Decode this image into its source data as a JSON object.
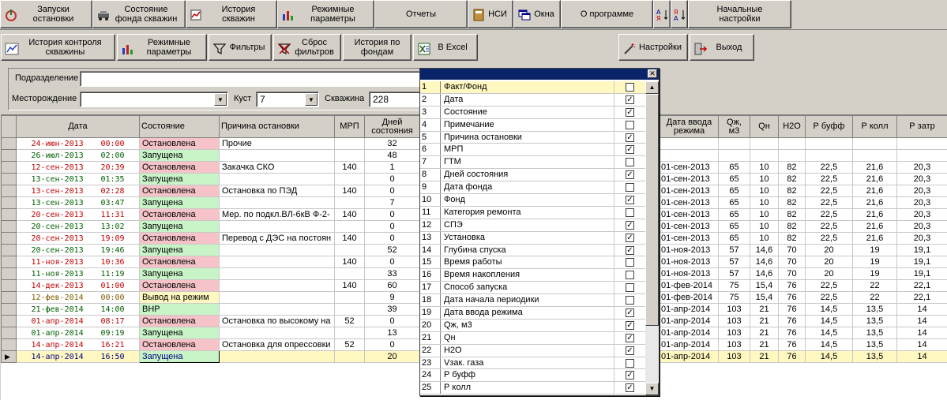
{
  "toolbar1": [
    {
      "label": "Запуски\nостановки",
      "icon": "power-icon"
    },
    {
      "label": "Состояние\nфонда скважин",
      "icon": "car-icon"
    },
    {
      "label": "История\nскважин",
      "icon": "history-icon"
    },
    {
      "label": "Режимные\nпараметры",
      "icon": "bar-chart-icon"
    },
    {
      "label": "Отчеты",
      "icon": ""
    },
    {
      "label": "НСИ",
      "icon": "book-icon"
    },
    {
      "label": "Окна",
      "icon": "windows-icon"
    },
    {
      "label": "О программе",
      "icon": ""
    },
    {
      "label": "",
      "icon": "sort-az-icon"
    },
    {
      "label": "",
      "icon": "sort-za-icon"
    },
    {
      "label": "Начальные\nнастройки",
      "icon": ""
    }
  ],
  "toolbar2": [
    {
      "label": "История контроля\nскважины",
      "icon": "chart-line-icon"
    },
    {
      "label": "Режимные\nпараметры",
      "icon": "bar-chart-icon"
    },
    {
      "label": "Фильтры",
      "icon": "filter-icon"
    },
    {
      "label": "Сброс\nфильтров",
      "icon": "filter-reset-icon"
    },
    {
      "label": "История по\nфондам",
      "icon": ""
    },
    {
      "label": "В Excel",
      "icon": "excel-icon"
    },
    {
      "label": "Настройки",
      "icon": "settings-wand-icon"
    },
    {
      "label": "Выход",
      "icon": "exit-icon"
    }
  ],
  "filter": {
    "division_label": "Подразделение",
    "division_value": "",
    "field_label": "Месторождение",
    "field_value": "",
    "pad_label": "Куст",
    "pad_value": "7",
    "well_label": "Скважина",
    "well_value": "228"
  },
  "grid": {
    "left_headers": [
      "Дата",
      "Состояние",
      "Причина остановки",
      "МРП",
      "Дней\nсостояния"
    ],
    "right_headers": [
      "Дата ввода\nрежима",
      "Qж,\nм3",
      "Qн",
      "H2O",
      "Р буфф",
      "Р колл",
      "Р затр"
    ],
    "rows": [
      {
        "date": "24-июн-2013",
        "time": "00:00",
        "state": "Остановлена",
        "reason": "Прочие",
        "mrp": "",
        "days": "32",
        "cls": "red",
        "rd": "",
        "qj": "",
        "qn": "",
        "h2o": "",
        "pb": "",
        "pk": "",
        "pz": ""
      },
      {
        "date": "26-июл-2013",
        "time": "02:00",
        "state": "Запущена",
        "reason": "",
        "mrp": "",
        "days": "48",
        "cls": "green",
        "rd": "",
        "qj": "",
        "qn": "",
        "h2o": "",
        "pb": "",
        "pk": "",
        "pz": ""
      },
      {
        "date": "12-сен-2013",
        "time": "20:39",
        "state": "Остановлена",
        "reason": "Закачка СКО",
        "mrp": "140",
        "days": "1",
        "cls": "red",
        "rd": "01-сен-2013",
        "qj": "65",
        "qn": "10",
        "h2o": "82",
        "pb": "22,5",
        "pk": "21,6",
        "pz": "20,3"
      },
      {
        "date": "13-сен-2013",
        "time": "01:35",
        "state": "Запущена",
        "reason": "",
        "mrp": "",
        "days": "0",
        "cls": "green",
        "rd": "01-сен-2013",
        "qj": "65",
        "qn": "10",
        "h2o": "82",
        "pb": "22,5",
        "pk": "21,6",
        "pz": "20,3"
      },
      {
        "date": "13-сен-2013",
        "time": "02:28",
        "state": "Остановлена",
        "reason": "Остановка по ПЭД",
        "mrp": "140",
        "days": "0",
        "cls": "red",
        "rd": "01-сен-2013",
        "qj": "65",
        "qn": "10",
        "h2o": "82",
        "pb": "22,5",
        "pk": "21,6",
        "pz": "20,3"
      },
      {
        "date": "13-сен-2013",
        "time": "03:47",
        "state": "Запущена",
        "reason": "",
        "mrp": "",
        "days": "7",
        "cls": "green",
        "rd": "01-сен-2013",
        "qj": "65",
        "qn": "10",
        "h2o": "82",
        "pb": "22,5",
        "pk": "21,6",
        "pz": "20,3"
      },
      {
        "date": "20-сен-2013",
        "time": "11:31",
        "state": "Остановлена",
        "reason": "Мер. по подкл.ВЛ-6кВ Ф-2-",
        "mrp": "140",
        "days": "0",
        "cls": "red",
        "rd": "01-сен-2013",
        "qj": "65",
        "qn": "10",
        "h2o": "82",
        "pb": "22,5",
        "pk": "21,6",
        "pz": "20,3"
      },
      {
        "date": "20-сен-2013",
        "time": "13:02",
        "state": "Запущена",
        "reason": "",
        "mrp": "",
        "days": "0",
        "cls": "green",
        "rd": "01-сен-2013",
        "qj": "65",
        "qn": "10",
        "h2o": "82",
        "pb": "22,5",
        "pk": "21,6",
        "pz": "20,3"
      },
      {
        "date": "20-сен-2013",
        "time": "19:09",
        "state": "Остановлена",
        "reason": "Перевод с ДЭС на постоян",
        "mrp": "140",
        "days": "0",
        "cls": "red",
        "rd": "01-сен-2013",
        "qj": "65",
        "qn": "10",
        "h2o": "82",
        "pb": "22,5",
        "pk": "21,6",
        "pz": "20,3"
      },
      {
        "date": "20-сен-2013",
        "time": "19:46",
        "state": "Запущена",
        "reason": "",
        "mrp": "",
        "days": "52",
        "cls": "green",
        "rd": "01-ноя-2013",
        "qj": "57",
        "qn": "14,6",
        "h2o": "70",
        "pb": "20",
        "pk": "19",
        "pz": "19,1"
      },
      {
        "date": "11-ноя-2013",
        "time": "10:36",
        "state": "Остановлена",
        "reason": "",
        "mrp": "140",
        "days": "0",
        "cls": "red",
        "rd": "01-ноя-2013",
        "qj": "57",
        "qn": "14,6",
        "h2o": "70",
        "pb": "20",
        "pk": "19",
        "pz": "19,1"
      },
      {
        "date": "11-ноя-2013",
        "time": "11:19",
        "state": "Запущена",
        "reason": "",
        "mrp": "",
        "days": "33",
        "cls": "green",
        "rd": "01-ноя-2013",
        "qj": "57",
        "qn": "14,6",
        "h2o": "70",
        "pb": "20",
        "pk": "19",
        "pz": "19,1"
      },
      {
        "date": "14-дек-2013",
        "time": "01:00",
        "state": "Остановлена",
        "reason": "",
        "mrp": "140",
        "days": "60",
        "cls": "red",
        "rd": "01-фев-2014",
        "qj": "75",
        "qn": "15,4",
        "h2o": "76",
        "pb": "22,5",
        "pk": "22",
        "pz": "22,1"
      },
      {
        "date": "12-фев-2014",
        "time": "00:00",
        "state": "Вывод на режим",
        "reason": "",
        "mrp": "",
        "days": "9",
        "cls": "yellow",
        "rd": "01-фев-2014",
        "qj": "75",
        "qn": "15,4",
        "h2o": "76",
        "pb": "22,5",
        "pk": "22",
        "pz": "22,1"
      },
      {
        "date": "21-фев-2014",
        "time": "14:00",
        "state": "ВНР",
        "reason": "",
        "mrp": "",
        "days": "39",
        "cls": "green",
        "rd": "01-апр-2014",
        "qj": "103",
        "qn": "21",
        "h2o": "76",
        "pb": "14,5",
        "pk": "13,5",
        "pz": "14"
      },
      {
        "date": "01-апр-2014",
        "time": "08:17",
        "state": "Остановлена",
        "reason": "Остановка по высокому на",
        "mrp": "52",
        "days": "0",
        "cls": "red",
        "rd": "01-апр-2014",
        "qj": "103",
        "qn": "21",
        "h2o": "76",
        "pb": "14,5",
        "pk": "13,5",
        "pz": "14"
      },
      {
        "date": "01-апр-2014",
        "time": "09:19",
        "state": "Запущена",
        "reason": "",
        "mrp": "",
        "days": "13",
        "cls": "green",
        "rd": "01-апр-2014",
        "qj": "103",
        "qn": "21",
        "h2o": "76",
        "pb": "14,5",
        "pk": "13,5",
        "pz": "14"
      },
      {
        "date": "14-апр-2014",
        "time": "16:21",
        "state": "Остановлена",
        "reason": "Остановка для опрессовки",
        "mrp": "52",
        "days": "0",
        "cls": "red",
        "rd": "01-апр-2014",
        "qj": "103",
        "qn": "21",
        "h2o": "76",
        "pb": "14,5",
        "pk": "13,5",
        "pz": "14"
      },
      {
        "date": "14-апр-2014",
        "time": "16:50",
        "state": "Запущена",
        "reason": "",
        "mrp": "",
        "days": "20",
        "cls": "current",
        "rd": "01-апр-2014",
        "qj": "103",
        "qn": "21",
        "h2o": "76",
        "pb": "14,5",
        "pk": "13,5",
        "pz": "14"
      }
    ]
  },
  "column_picker": {
    "items": [
      {
        "n": "1",
        "label": "Факт/Фонд",
        "checked": false
      },
      {
        "n": "2",
        "label": "Дата",
        "checked": true
      },
      {
        "n": "3",
        "label": "Состояние",
        "checked": true
      },
      {
        "n": "4",
        "label": "Примечание",
        "checked": false
      },
      {
        "n": "5",
        "label": "Причина остановки",
        "checked": true
      },
      {
        "n": "6",
        "label": "МРП",
        "checked": true
      },
      {
        "n": "7",
        "label": "ГТМ",
        "checked": false
      },
      {
        "n": "8",
        "label": "Дней состояния",
        "checked": true
      },
      {
        "n": "9",
        "label": "Дата фонда",
        "checked": false
      },
      {
        "n": "10",
        "label": "Фонд",
        "checked": true
      },
      {
        "n": "11",
        "label": "Категория ремонта",
        "checked": false
      },
      {
        "n": "12",
        "label": "СПЭ",
        "checked": true
      },
      {
        "n": "13",
        "label": "Установка",
        "checked": true
      },
      {
        "n": "14",
        "label": "Глубина спуска",
        "checked": true
      },
      {
        "n": "15",
        "label": "Время работы",
        "checked": false
      },
      {
        "n": "16",
        "label": "Время накопления",
        "checked": false
      },
      {
        "n": "17",
        "label": "Способ запуска",
        "checked": false
      },
      {
        "n": "18",
        "label": "Дата начала периодики",
        "checked": false
      },
      {
        "n": "19",
        "label": "Дата ввода режима",
        "checked": true
      },
      {
        "n": "20",
        "label": "Qж, м3",
        "checked": true
      },
      {
        "n": "21",
        "label": "Qн",
        "checked": true
      },
      {
        "n": "22",
        "label": "H2O",
        "checked": true
      },
      {
        "n": "23",
        "label": "Vзак. газа",
        "checked": false
      },
      {
        "n": "24",
        "label": "Р буфф",
        "checked": true
      },
      {
        "n": "25",
        "label": "Р колл",
        "checked": true
      }
    ]
  },
  "colors": {
    "stopped": "#f6c4c8",
    "running": "#c8f4c8",
    "output": "#fff8c0",
    "title": "#0a246a"
  }
}
